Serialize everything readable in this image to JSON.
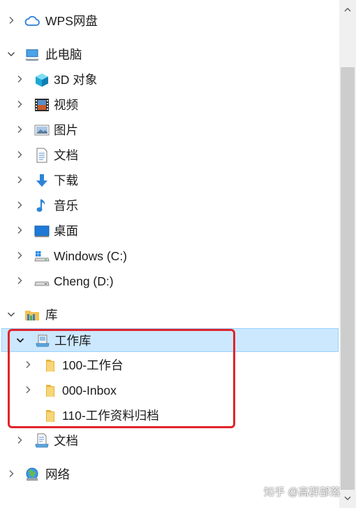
{
  "tree": {
    "wps": "WPS网盘",
    "this_pc": "此电脑",
    "objects3d": "3D 对象",
    "videos": "视频",
    "pictures": "图片",
    "documents": "文档",
    "downloads": "下载",
    "music": "音乐",
    "desktop": "桌面",
    "drive_c": "Windows  (C:)",
    "drive_d": "Cheng (D:)",
    "libraries": "库",
    "work_library": "工作库",
    "folder_100": "100-工作台",
    "folder_000": "000-Inbox",
    "folder_110": "110-工作资料归档",
    "lib_documents": "文档",
    "network": "网络"
  },
  "watermark": "知乎 @高群部落",
  "colors": {
    "selection_bg": "#cce8ff",
    "selection_border": "#99d1ff",
    "highlight_border": "#e0242b",
    "scrollbar_track": "#f0f0f0",
    "scrollbar_thumb": "#cdcdcd"
  }
}
